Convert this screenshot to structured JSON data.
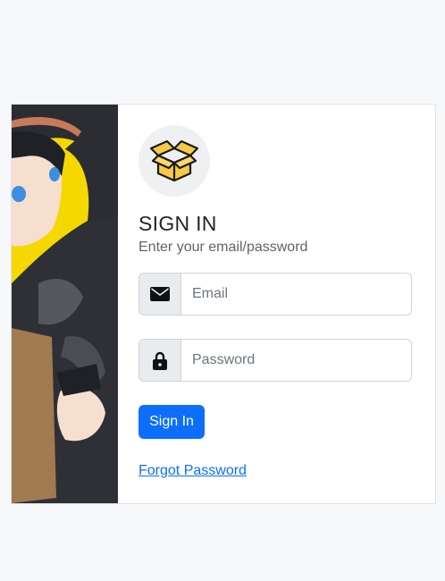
{
  "login": {
    "title": "SIGN IN",
    "subtitle": "Enter your email/password",
    "email_placeholder": "Email",
    "email_value": "",
    "password_placeholder": "Password",
    "password_value": "",
    "submit_label": "Sign In",
    "forgot_label": "Forgot Password"
  },
  "icons": {
    "logo": "open-box-icon",
    "email": "envelope-icon",
    "password": "lock-icon"
  },
  "colors": {
    "primary": "#0d6efd",
    "hero_background": "#f5d800",
    "logo_box": "#f7c948"
  }
}
